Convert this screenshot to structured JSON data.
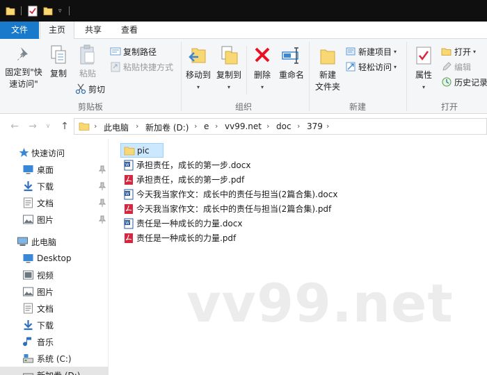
{
  "window": {
    "qat_icons": [
      "folder-icon",
      "properties-icon",
      "new-folder-icon",
      "customize-qat-icon"
    ]
  },
  "ribbon_tabs": [
    {
      "label": "文件",
      "active": false
    },
    {
      "label": "主页",
      "active": true
    },
    {
      "label": "共享",
      "active": false
    },
    {
      "label": "查看",
      "active": false
    }
  ],
  "ribbon": {
    "clipboard": {
      "group_label": "剪贴板",
      "pin_quick_access_line1": "固定到\"快",
      "pin_quick_access_line2": "速访问\"",
      "copy": "复制",
      "paste": "粘贴",
      "copy_path": "复制路径",
      "paste_shortcut": "粘贴快捷方式",
      "cut": "剪切"
    },
    "organize": {
      "group_label": "组织",
      "move_to": "移动到",
      "copy_to": "复制到",
      "delete": "删除",
      "rename": "重命名"
    },
    "new": {
      "group_label": "新建",
      "new_folder_line1": "新建",
      "new_folder_line2": "文件夹",
      "new_item": "新建项目",
      "easy_access": "轻松访问"
    },
    "open": {
      "group_label": "打开",
      "properties": "属性",
      "open": "打开",
      "edit": "编辑",
      "history": "历史记录"
    }
  },
  "address": {
    "breadcrumbs": [
      "此电脑",
      "新加卷 (D:)",
      "e",
      "vv99.net",
      "doc",
      "379"
    ]
  },
  "nav_pane": {
    "quick_access": "快速访问",
    "quick_items": [
      {
        "label": "桌面",
        "icon": "desktop-icon"
      },
      {
        "label": "下载",
        "icon": "download-icon"
      },
      {
        "label": "文档",
        "icon": "documents-icon"
      },
      {
        "label": "图片",
        "icon": "pictures-icon"
      }
    ],
    "this_pc": "此电脑",
    "pc_items": [
      {
        "label": "Desktop",
        "icon": "desktop-icon"
      },
      {
        "label": "视频",
        "icon": "videos-icon"
      },
      {
        "label": "图片",
        "icon": "pictures-icon"
      },
      {
        "label": "文档",
        "icon": "documents-icon"
      },
      {
        "label": "下载",
        "icon": "download-icon"
      },
      {
        "label": "音乐",
        "icon": "music-icon"
      },
      {
        "label": "系统 (C:)",
        "icon": "drive-c-icon"
      },
      {
        "label": "新加卷 (D:)",
        "icon": "drive-d-icon"
      }
    ]
  },
  "files": [
    {
      "name": "pic",
      "type": "folder",
      "selected": true
    },
    {
      "name": "承担责任，成长的第一步.docx",
      "type": "docx"
    },
    {
      "name": "承担责任，成长的第一步.pdf",
      "type": "pdf"
    },
    {
      "name": "今天我当家作文：成长中的责任与担当(2篇合集).docx",
      "type": "docx"
    },
    {
      "name": "今天我当家作文：成长中的责任与担当(2篇合集).pdf",
      "type": "pdf"
    },
    {
      "name": "责任是一种成长的力量.docx",
      "type": "docx"
    },
    {
      "name": "责任是一种成长的力量.pdf",
      "type": "pdf"
    }
  ],
  "watermark": "vv99.net",
  "colors": {
    "file_tab": "#1979ca",
    "selection": "#cce8ff",
    "folder": "#f8d775",
    "pdf": "#d7263d",
    "word": "#2b579a",
    "delete": "#e81123"
  }
}
